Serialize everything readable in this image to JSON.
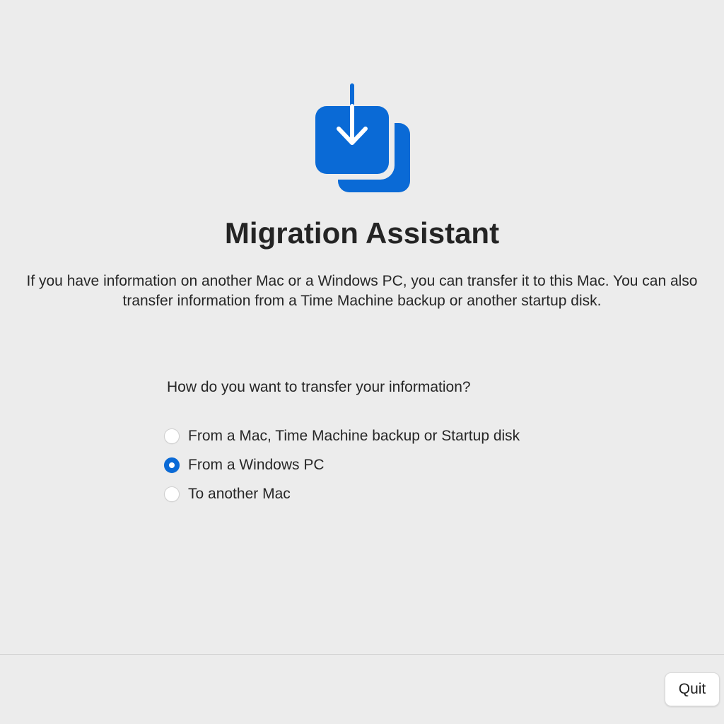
{
  "app": {
    "icon": "migration-download-icon",
    "title": "Migration Assistant",
    "accent_color": "#0a6ad6"
  },
  "description": {
    "line1": "If you have information on another Mac or a Windows PC, you can transfer it to this Mac. You can also",
    "line2": "transfer information from a Time Machine backup or another startup disk."
  },
  "transfer": {
    "question": "How do you want to transfer your information?",
    "options": [
      {
        "label": "From a Mac, Time Machine backup or Startup disk",
        "selected": false
      },
      {
        "label": "From a Windows PC",
        "selected": true
      },
      {
        "label": "To another Mac",
        "selected": false
      }
    ]
  },
  "footer": {
    "quit_label": "Quit"
  }
}
